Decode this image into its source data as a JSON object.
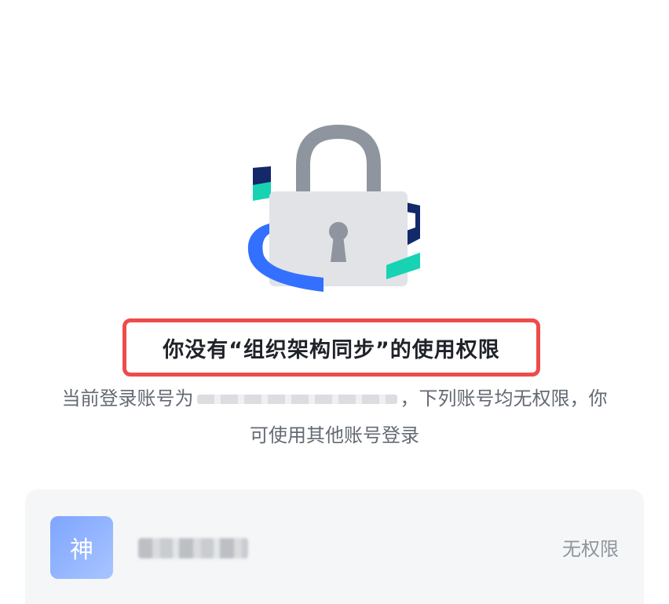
{
  "title": "你没有“组织架构同步”的使用权限",
  "description": {
    "prefix": "当前登录账号为",
    "suffix": "，下列账号均无权限，你",
    "line2": "可使用其他账号登录"
  },
  "account": {
    "avatar_text": "神",
    "status": "无权限"
  },
  "icons": {
    "illustration": "lock-illustration-icon"
  },
  "colors": {
    "highlight_border": "#ee4b4b",
    "ring_teal": "#18d2b4",
    "ring_blue": "#3370ff",
    "ring_navy": "#13296a",
    "lock_body": "#e1e3e6",
    "lock_shackle": "#8f959e"
  }
}
